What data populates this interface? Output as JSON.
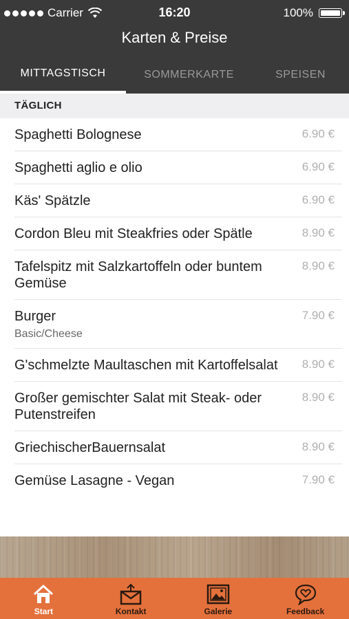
{
  "status": {
    "carrier": "Carrier",
    "time": "16:20",
    "battery": "100%"
  },
  "nav": {
    "title": "Karten & Preise"
  },
  "tabs": [
    {
      "label": "MITTAGSTISCH",
      "active": true
    },
    {
      "label": "SOMMERKARTE",
      "active": false
    },
    {
      "label": "SPEISEN",
      "active": false
    }
  ],
  "section": {
    "title": "TÄGLICH"
  },
  "menu": [
    {
      "name": "Spaghetti Bolognese",
      "price": "6.90 €"
    },
    {
      "name": "Spaghetti aglio e olio",
      "price": "6.90 €"
    },
    {
      "name": "Käs' Spätzle",
      "price": "6.90 €"
    },
    {
      "name": "Cordon Bleu mit Steakfries oder Spätle",
      "price": "8.90 €"
    },
    {
      "name": "Tafelspitz mit Salzkartoffeln oder buntem Gemüse",
      "price": "8.90 €"
    },
    {
      "name": "Burger",
      "sub": "Basic/Cheese",
      "price": "7.90 €"
    },
    {
      "name": "G'schmelzte Maultaschen mit Kartoffelsalat",
      "price": "8.90 €"
    },
    {
      "name": "Großer gemischter Salat mit Steak- oder Putenstreifen",
      "price": "8.90 €"
    },
    {
      "name": "GriechischerBauernsalat",
      "price": "8.90 €"
    },
    {
      "name": "Gemüse Lasagne - Vegan",
      "price": "7.90 €"
    }
  ],
  "tabbar": [
    {
      "label": "Start",
      "icon": "home-icon",
      "active": true
    },
    {
      "label": "Kontakt",
      "icon": "mail-icon",
      "active": false
    },
    {
      "label": "Galerie",
      "icon": "gallery-icon",
      "active": false
    },
    {
      "label": "Feedback",
      "icon": "feedback-icon",
      "active": false
    }
  ],
  "colors": {
    "bar": "#3a3a3a",
    "accent": "#e4713c",
    "price": "#b0b0b0"
  }
}
